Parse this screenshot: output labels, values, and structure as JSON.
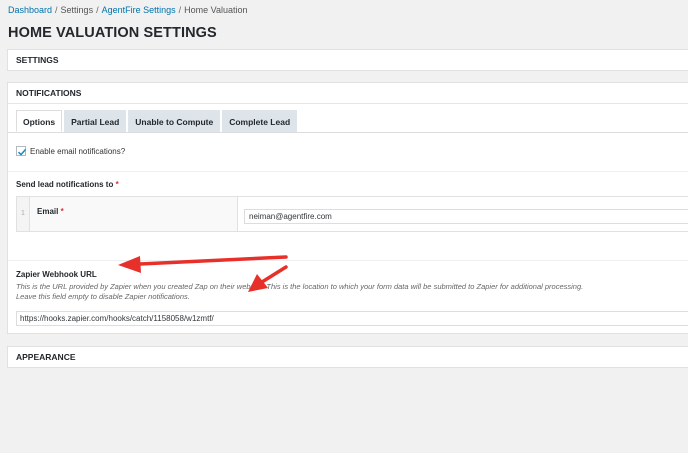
{
  "breadcrumb": {
    "dashboard": "Dashboard",
    "sep1": "/",
    "settings": "Settings",
    "sep2": "/",
    "agentfire": "AgentFire Settings",
    "sep3": "/",
    "current": "Home Valuation"
  },
  "page_title": "HOME VALUATION SETTINGS",
  "panels": {
    "settings": "SETTINGS",
    "notifications": "NOTIFICATIONS",
    "appearance": "APPEARANCE"
  },
  "tabs": [
    {
      "label": "Options",
      "active": true
    },
    {
      "label": "Partial Lead",
      "active": false
    },
    {
      "label": "Unable to Compute",
      "active": false
    },
    {
      "label": "Complete Lead",
      "active": false
    }
  ],
  "email_notifications": {
    "label": "Enable email notifications?",
    "checked": true
  },
  "send_to": {
    "label": "Send lead notifications to",
    "required_mark": "*",
    "rows": [
      {
        "index": "1",
        "field_label": "Email",
        "required_mark": "*",
        "value": "neiman@agentfire.com"
      }
    ]
  },
  "zapier": {
    "label": "Zapier Webhook URL",
    "description_line1": "This is the URL provided by Zapier when you created Zap on their website. This is the location to which your form data will be submitted to Zapier for additional processing.",
    "description_line2": "Leave this field empty to disable Zapier notifications.",
    "value": "https://hooks.zapier.com/hooks/catch/1158058/w1zmtf/"
  },
  "colors": {
    "link": "#0073aa",
    "required": "#dc3232",
    "annotation_arrow": "#e8302a",
    "checkmark": "#1e8cbe"
  },
  "icons": {
    "checkbox": "checkmark-icon",
    "annotation": "red-arrow-icon"
  }
}
